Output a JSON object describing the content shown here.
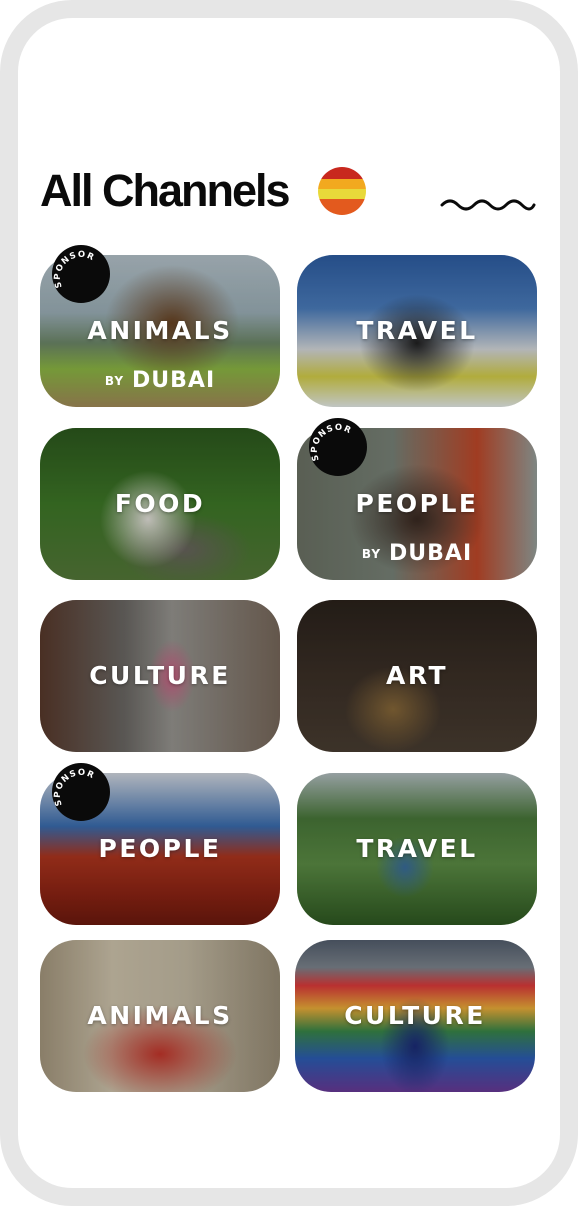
{
  "header": {
    "title": "All Channels",
    "flag_colors": [
      "#c8281e",
      "#f2a91f",
      "#e8d93a",
      "#e35a1e"
    ]
  },
  "sponsor_badge": {
    "text": "SPONSOR"
  },
  "sponsor_byline": {
    "by": "BY",
    "brand": "DUBAI"
  },
  "channels": [
    {
      "label": "ANIMALS",
      "sponsored": true,
      "byline": true,
      "image": "horse-rider-in-water"
    },
    {
      "label": "TRAVEL",
      "sponsored": false,
      "byline": false,
      "image": "bodyboarder-in-surf"
    },
    {
      "label": "FOOD",
      "sponsored": false,
      "byline": false,
      "image": "biker-in-trees"
    },
    {
      "label": "PEOPLE",
      "sponsored": true,
      "byline": true,
      "image": "children-group"
    },
    {
      "label": "CULTURE",
      "sponsored": false,
      "byline": false,
      "image": "street-dancers"
    },
    {
      "label": "ART",
      "sponsored": false,
      "byline": false,
      "image": "bell-foundry"
    },
    {
      "label": "PEOPLE",
      "sponsored": true,
      "byline": false,
      "image": "crawfish-boil"
    },
    {
      "label": "TRAVEL",
      "sponsored": false,
      "byline": false,
      "image": "tree-canopy"
    },
    {
      "label": "ANIMALS",
      "sponsored": false,
      "byline": false,
      "image": "marching-band"
    },
    {
      "label": "CULTURE",
      "sponsored": false,
      "byline": false,
      "image": "rainbow-parade"
    }
  ]
}
